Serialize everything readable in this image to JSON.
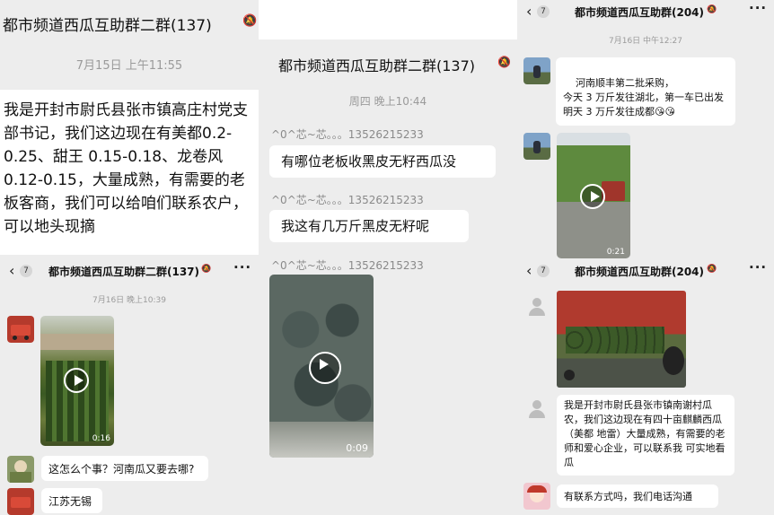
{
  "p1": {
    "title": "都市频道西瓜互助群二群(137)",
    "time": "7月15日 上午11:55",
    "message": "我是开封市尉氏县张市镇高庄村党支部书记，我们这边现在有美都0.2-0.25、甜王 0.15-0.18、龙卷风 0.12-0.15，大量成熟，有需要的老板客商，我们可以给咱们联系农户，可以地头现摘"
  },
  "p2": {
    "title": "都市频道西瓜互助群二群(137)",
    "time": "周四 晚上10:44",
    "messages": [
      {
        "sender": "^0^芯~芯。。。13526215233",
        "text": "有哪位老板收黑皮无籽西瓜没"
      },
      {
        "sender": "^0^芯~芯。。。13526215233",
        "text": "我这有几万斤黑皮无籽呢"
      },
      {
        "sender": "^0^芯~芯。。。13526215233",
        "video_duration": "0:09"
      }
    ]
  },
  "p3": {
    "back_count": "7",
    "title": "都市频道西瓜互助群(204)",
    "time": "7月16日 中午12:27",
    "message": "河南顺丰第二批采购，\n今天 3 万斤发往湖北，第一车已出发\n明天 3 万斤发往成都",
    "emoji": "😘😘",
    "video_duration": "0:21"
  },
  "p4": {
    "back_count": "7",
    "title": "都市频道西瓜互助群二群(137)",
    "time": "7月16日 晚上10:39",
    "video_duration": "0:16",
    "messages": [
      "这怎么个事？河南瓜又要去哪?",
      "江苏无锡"
    ]
  },
  "p5": {
    "back_count": "7",
    "title": "都市频道西瓜互助群(204)",
    "messages": [
      "我是开封市尉氏县张市镇南谢村瓜农，我们这边现在有四十亩麒麟西瓜（美都 地雷）大量成熟，有需要的老师和爱心企业，可以联系我 可实地看瓜",
      "有联系方式吗，我们电话沟通"
    ]
  },
  "icons": {
    "back": "chevron-left-icon",
    "mute": "bell-off-icon",
    "more": "more-icon",
    "play": "play-icon"
  }
}
